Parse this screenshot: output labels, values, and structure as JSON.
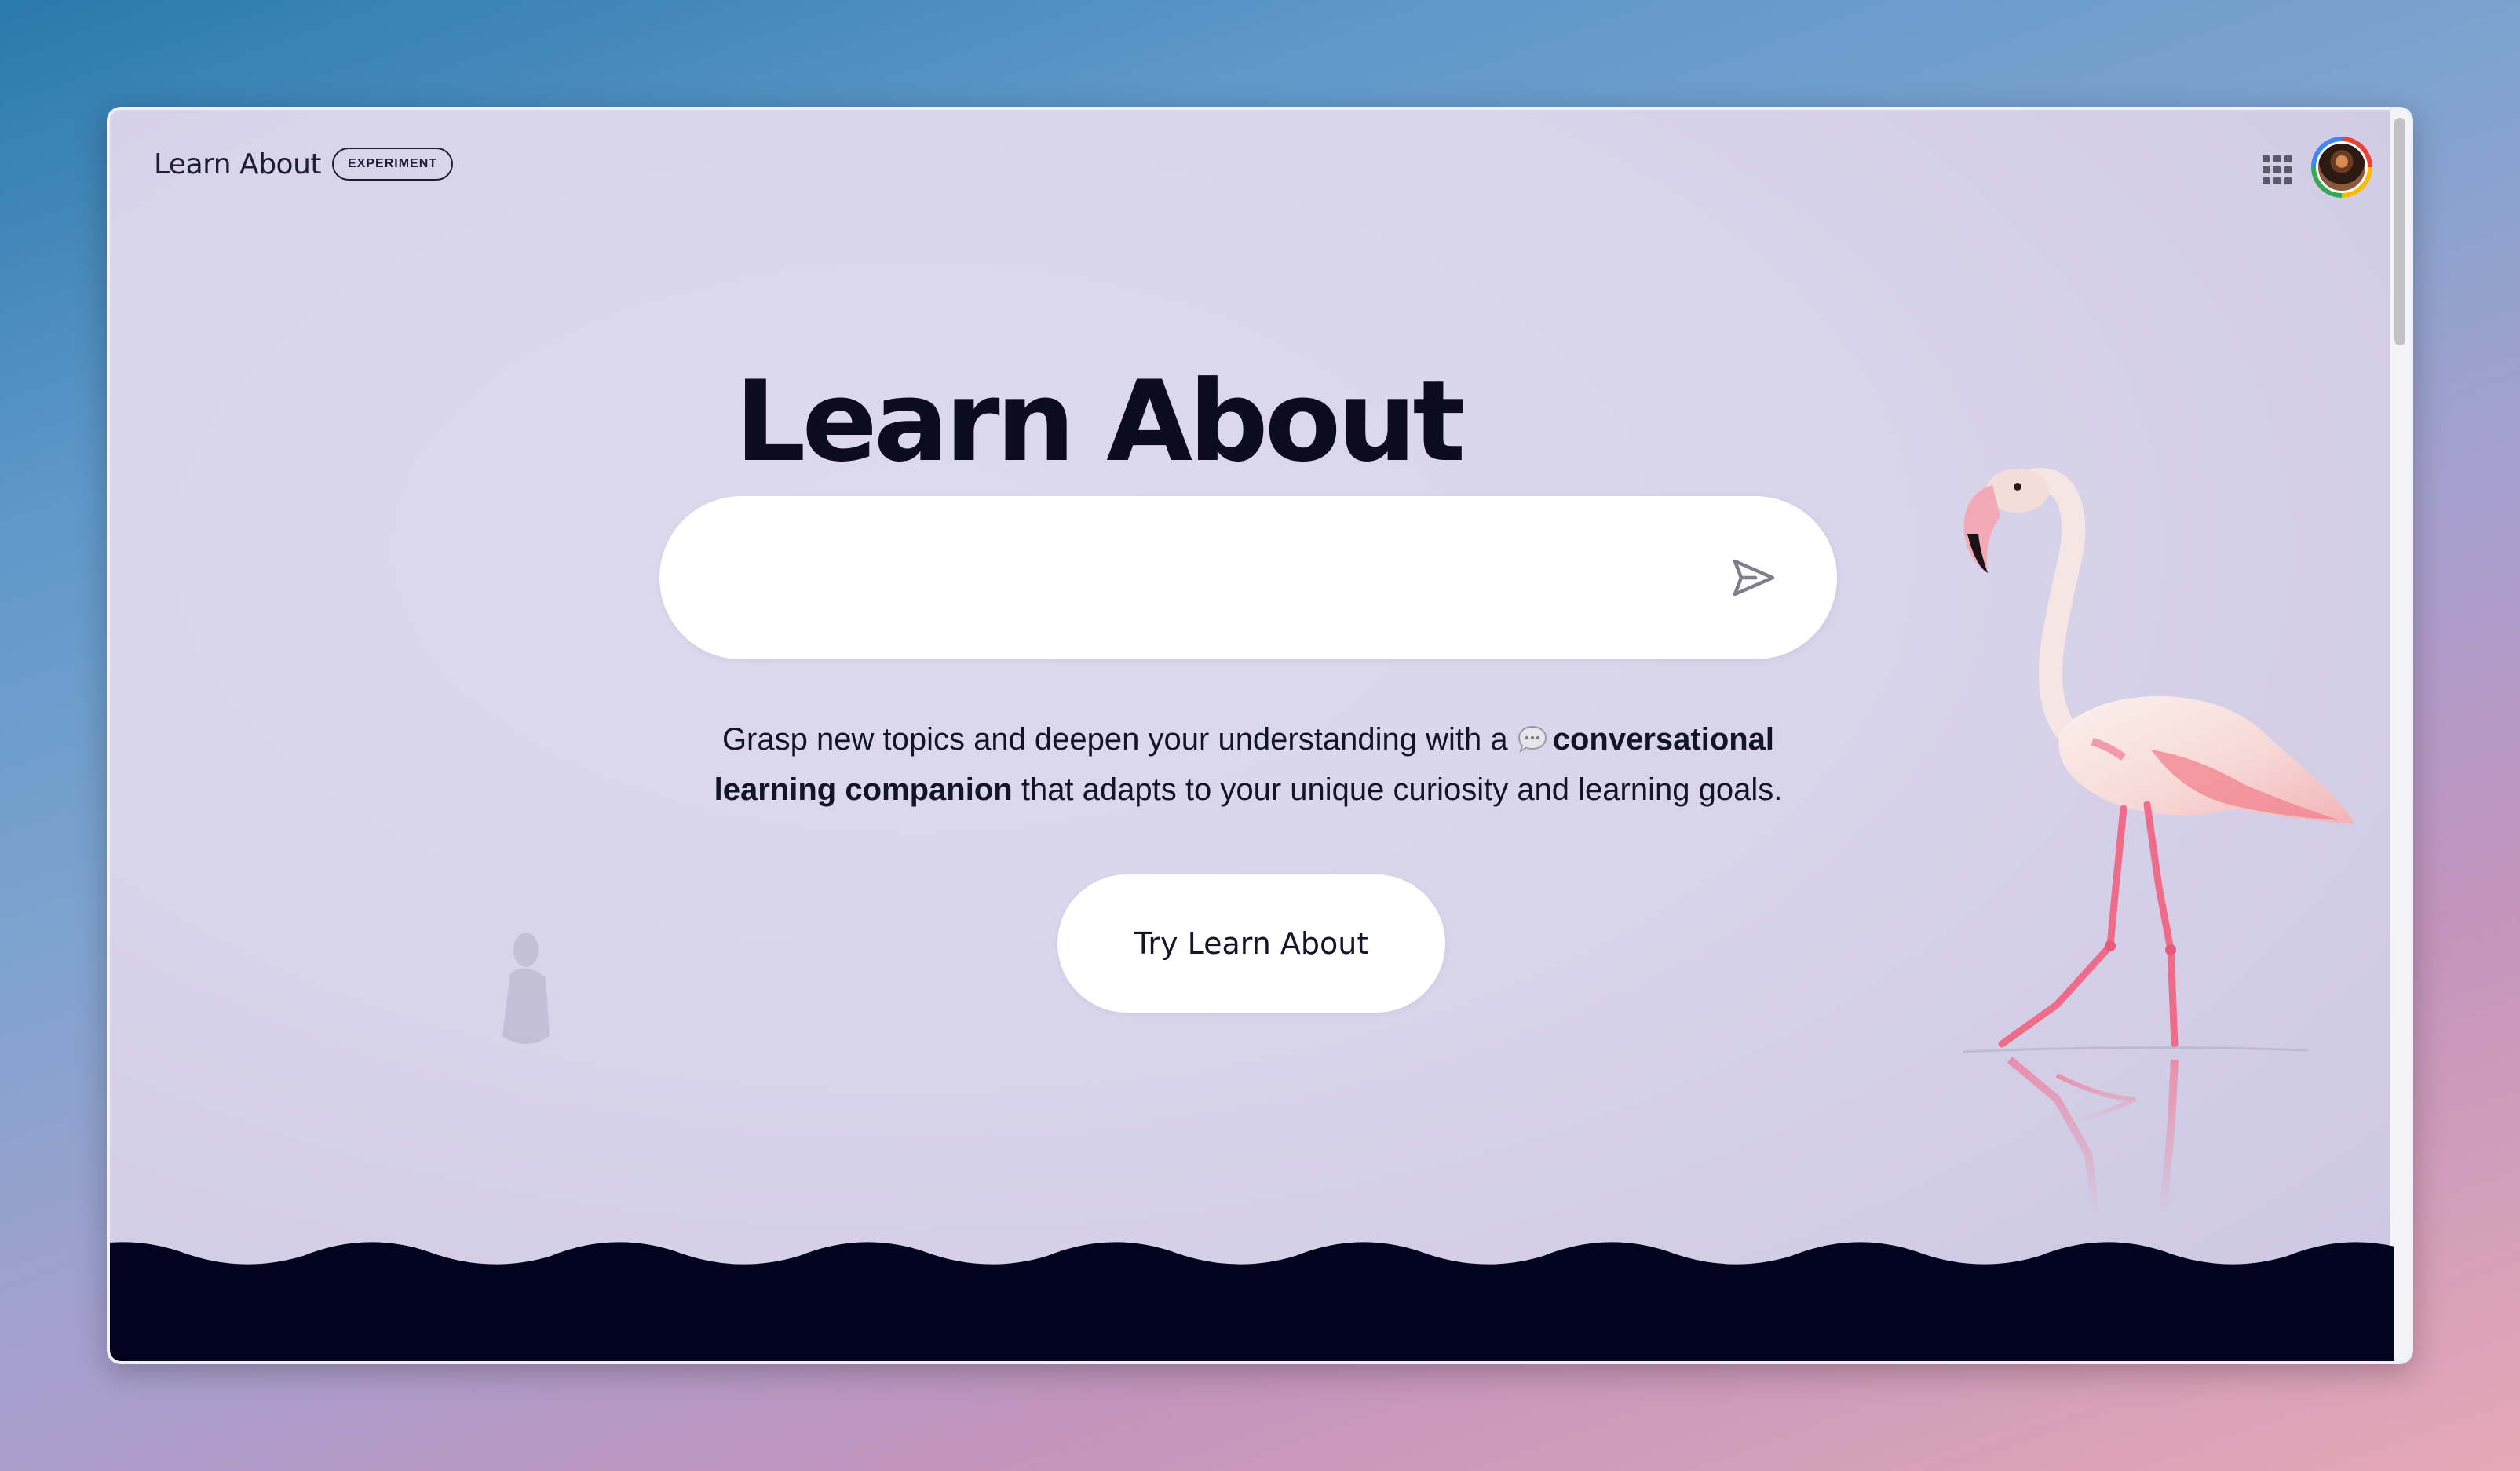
{
  "header": {
    "brand_name": "Learn About",
    "badge": "EXPERIMENT",
    "apps_icon": "apps-grid-icon",
    "avatar_icon": "user-avatar"
  },
  "hero": {
    "title": "Learn About",
    "search": {
      "placeholder": "",
      "value": "",
      "send_icon": "send-icon"
    },
    "description": {
      "part1": "Grasp new topics and deepen your understanding with a",
      "chat_icon": "chat-bubble-icon",
      "bold1": "conversational",
      "bold2": "learning companion",
      "part2": "that adapts to your unique curiosity and learning goals."
    },
    "cta_label": "Try Learn About"
  },
  "colors": {
    "footer_wave": "#02031e",
    "title_text": "#0d0c1e",
    "flamingo_pink": "#f07a96"
  }
}
